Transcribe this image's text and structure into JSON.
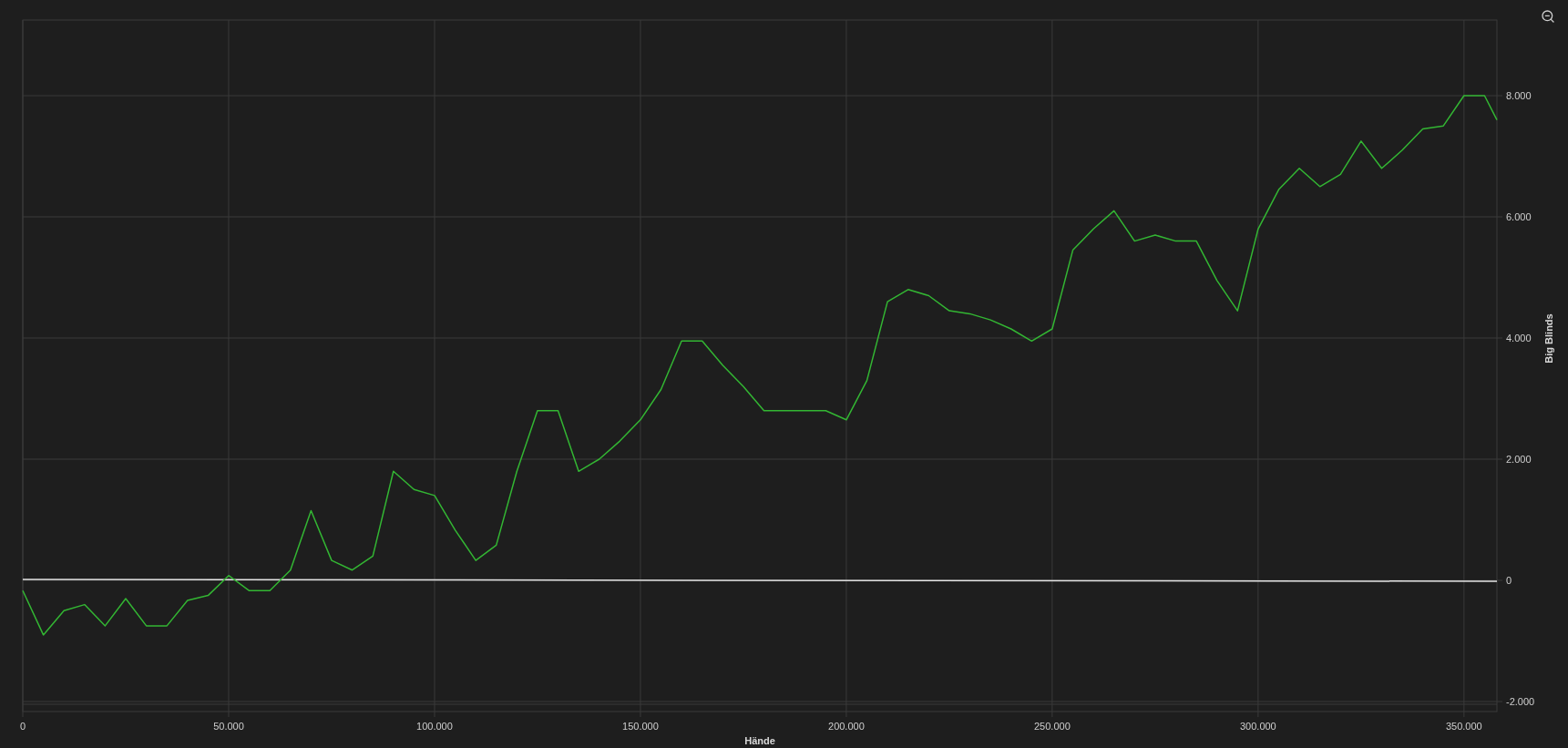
{
  "chart": {
    "chart_data": {
      "type": "line",
      "grid": true,
      "xlabel": "Hände",
      "ylabel": "Big Blinds",
      "x": [
        0,
        5000,
        10000,
        15000,
        20000,
        25000,
        30000,
        35000,
        40000,
        45000,
        50000,
        55000,
        60000,
        65000,
        70000,
        75000,
        80000,
        85000,
        90000,
        95000,
        100000,
        105000,
        110000,
        115000,
        120000,
        125000,
        130000,
        135000,
        140000,
        145000,
        150000,
        155000,
        160000,
        165000,
        170000,
        175000,
        180000,
        185000,
        190000,
        195000,
        200000,
        205000,
        210000,
        215000,
        220000,
        225000,
        230000,
        235000,
        240000,
        245000,
        250000,
        255000,
        260000,
        265000,
        270000,
        275000,
        280000,
        285000,
        290000,
        295000,
        300000,
        305000,
        310000,
        315000,
        320000,
        325000,
        330000,
        335000,
        340000,
        345000,
        350000,
        355000,
        358000
      ],
      "series": [
        {
          "color": "#33b633",
          "values": [
            -170,
            -900,
            -500,
            -400,
            -750,
            -300,
            -750,
            -750,
            -330,
            -250,
            80,
            -170,
            -170,
            170,
            1150,
            330,
            170,
            400,
            1800,
            1500,
            1400,
            830,
            330,
            580,
            1800,
            2800,
            2800,
            1800,
            2000,
            2300,
            2650,
            3150,
            3950,
            3950,
            3550,
            3200,
            2800,
            2800,
            2800,
            2800,
            2650,
            3300,
            4600,
            4800,
            4700,
            4450,
            4400,
            4300,
            4150,
            3950,
            4150,
            5450,
            5800,
            6100,
            5600,
            5700,
            5600,
            5600,
            4950,
            4450,
            5800,
            6450,
            6800,
            6500,
            6700,
            7250,
            6800,
            7100,
            7450,
            7500,
            8000,
            8000,
            7600
          ]
        }
      ],
      "xlim": [
        0,
        358000
      ],
      "ylim": [
        -2165,
        9248
      ],
      "xticks": [
        {
          "value": 0,
          "label": "0"
        },
        {
          "value": 50000,
          "label": "50.000"
        },
        {
          "value": 100000,
          "label": "100.000"
        },
        {
          "value": 150000,
          "label": "150.000"
        },
        {
          "value": 200000,
          "label": "200.000"
        },
        {
          "value": 250000,
          "label": "250.000"
        },
        {
          "value": 300000,
          "label": "300.000"
        },
        {
          "value": 350000,
          "label": "350.000"
        }
      ],
      "yticks": [
        {
          "value": -2000,
          "label": "-2.000"
        },
        {
          "value": 0,
          "label": "0"
        },
        {
          "value": 2000,
          "label": "2.000"
        },
        {
          "value": 4000,
          "label": "4.000"
        },
        {
          "value": 6000,
          "label": "6.000"
        },
        {
          "value": 8000,
          "label": "8.000"
        }
      ]
    }
  }
}
